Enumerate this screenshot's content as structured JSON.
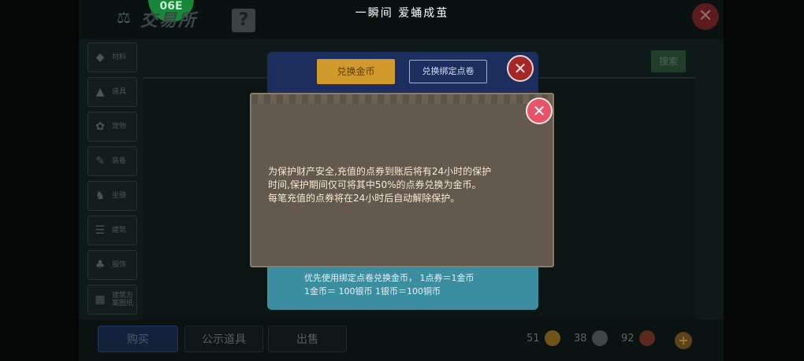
{
  "header": {
    "banner": "一瞬间 爱蛹成茧",
    "title": "交易所",
    "help_label": "?",
    "logo_text": "06E",
    "close_label": "✕"
  },
  "sidebar": {
    "items": [
      {
        "label": "材料",
        "icon": "material-icon"
      },
      {
        "label": "道具",
        "icon": "flask-icon"
      },
      {
        "label": "宠物",
        "icon": "paw-icon"
      },
      {
        "label": "装备",
        "icon": "equipment-icon"
      },
      {
        "label": "坐骑",
        "icon": "mount-icon"
      },
      {
        "label": "建筑",
        "icon": "building-icon"
      },
      {
        "label": "服饰",
        "icon": "clothing-icon"
      },
      {
        "label": "建筑方案图纸",
        "icon": "blueprint-icon"
      }
    ]
  },
  "main": {
    "search_label": "搜索"
  },
  "exchange": {
    "tab_gold": "兑换金币",
    "tab_bound": "兑换绑定点卷",
    "close_label": "✕",
    "note_line1": "优先使用绑定点卷兑换金币，  1点券＝1金币",
    "note_line2": "1金币＝ 100银币   1银币＝100铜币"
  },
  "modal": {
    "close_label": "✕",
    "line1": "为保护财产安全,充值的点券到账后将有24小时的保护",
    "line2": "时间,保护期间仅可将其中50%的点券兑换为金币。",
    "line3": "每笔充值的点券将在24小时后自动解除保护。"
  },
  "bottom": {
    "tabs": [
      "购买",
      "公示道具",
      "出售"
    ],
    "gold": "51",
    "silver": "38",
    "copper": "92",
    "plus_label": "+"
  },
  "colors": {
    "modal_bg": "#63594e",
    "modal_text": "#f5ead2",
    "close_red": "#e9536a",
    "gold_tab": "#d09b2c"
  }
}
